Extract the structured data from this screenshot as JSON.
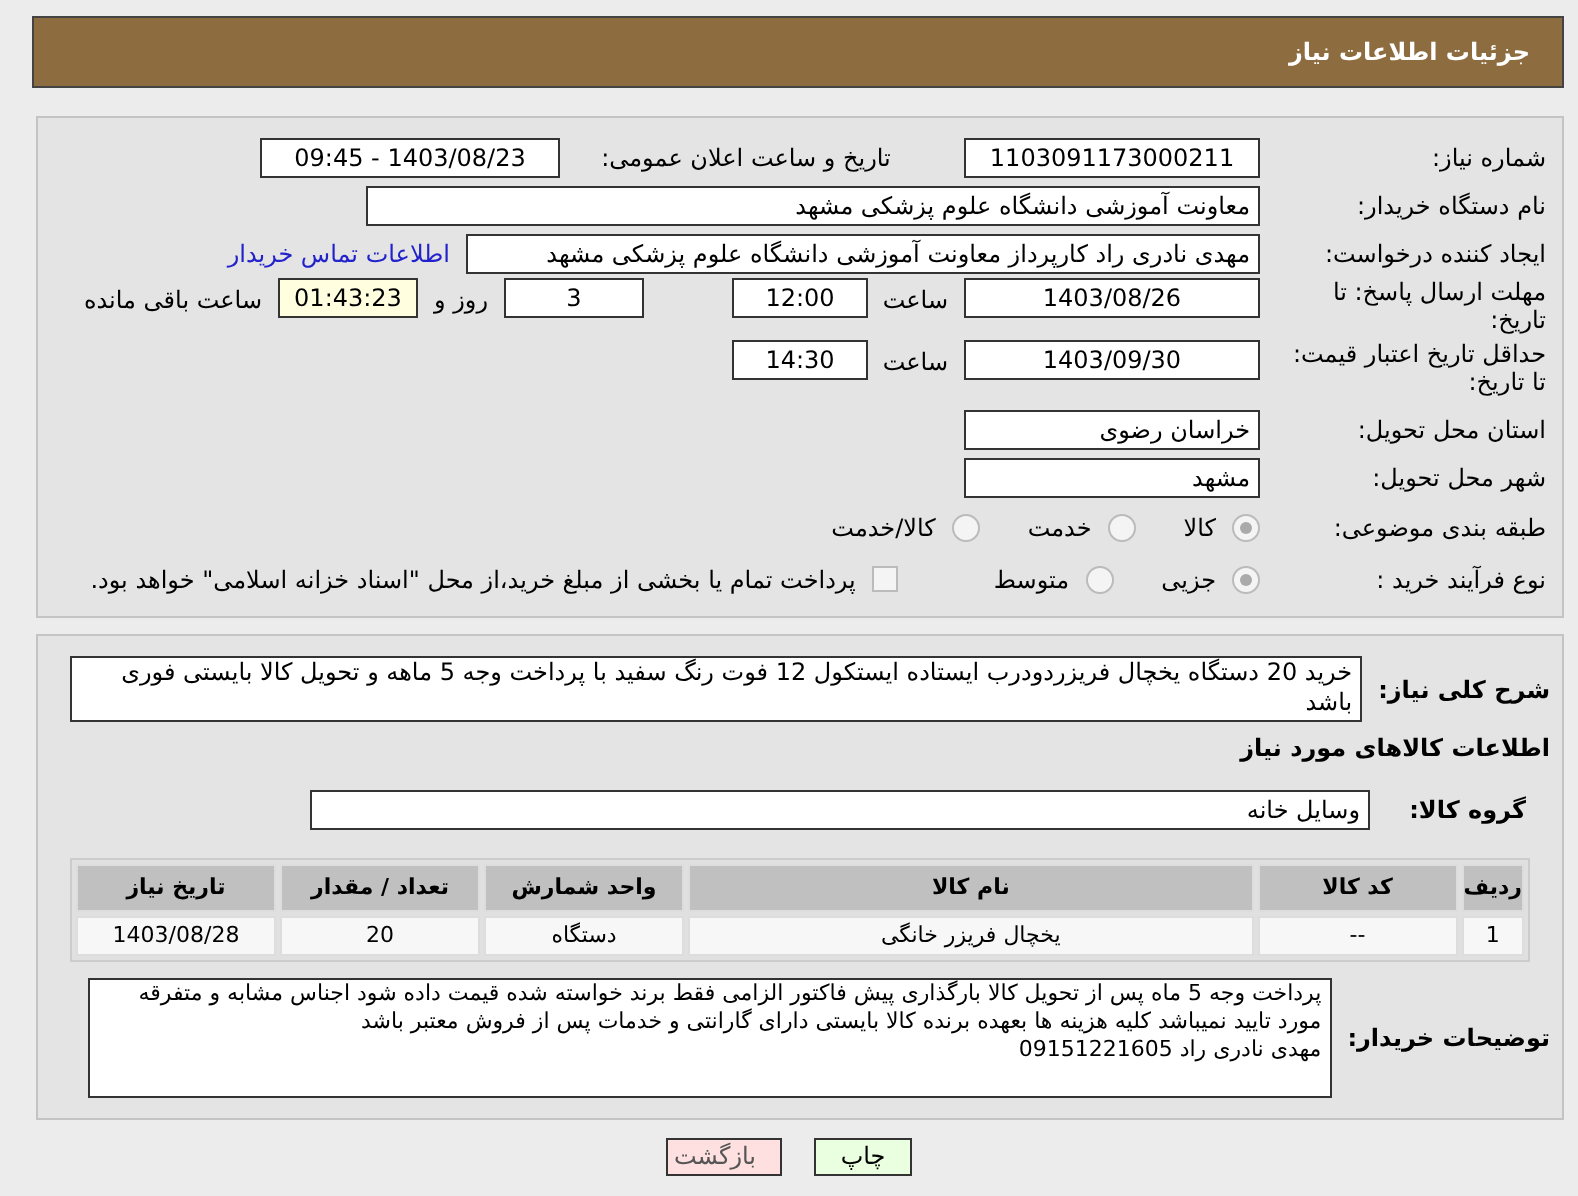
{
  "header": {
    "title": "جزئیات اطلاعات نیاز"
  },
  "need_number": {
    "label": "شماره نیاز:",
    "value": "1103091173000211"
  },
  "announce": {
    "label": "تاریخ و ساعت اعلان عمومی:",
    "value": "1403/08/23 - 09:45"
  },
  "buyer_org": {
    "label": "نام دستگاه خریدار:",
    "value": "معاونت آموزشی دانشگاه علوم پزشکی مشهد"
  },
  "requester": {
    "label": "ایجاد کننده درخواست:",
    "value": "مهدی نادری راد کارپرداز معاونت آموزشی دانشگاه علوم پزشکی مشهد",
    "link": "اطلاعات تماس خریدار"
  },
  "deadline": {
    "label": "مهلت ارسال پاسخ: تا تاریخ:",
    "date": "1403/08/26",
    "time_label": "ساعت",
    "time": "12:00",
    "days": "3",
    "days_label": "روز و",
    "remaining": "01:43:23",
    "remaining_label": "ساعت باقی مانده"
  },
  "validity": {
    "label": "حداقل تاریخ اعتبار قیمت: تا تاریخ:",
    "date": "1403/09/30",
    "time_label": "ساعت",
    "time": "14:30"
  },
  "province": {
    "label": "استان محل تحویل:",
    "value": "خراسان رضوی"
  },
  "city": {
    "label": "شهر محل تحویل:",
    "value": "مشهد"
  },
  "category": {
    "label": "طبقه بندی موضوعی:",
    "options": [
      {
        "label": "کالا",
        "selected": true
      },
      {
        "label": "خدمت",
        "selected": false
      },
      {
        "label": "کالا/خدمت",
        "selected": false
      }
    ]
  },
  "process": {
    "label": "نوع فرآیند خرید :",
    "options": [
      {
        "label": "جزیی",
        "selected": true
      },
      {
        "label": "متوسط",
        "selected": false
      }
    ],
    "treasury": {
      "label": "پرداخت تمام یا بخشی از مبلغ خرید،از محل \"اسناد خزانه اسلامی\" خواهد بود.",
      "checked": false
    }
  },
  "description": {
    "label": "شرح کلی نیاز:",
    "text": "خرید 20 دستگاه یخچال فریزردودرب ایستاده ایستکول 12 فوت رنگ سفید با پرداخت وجه 5 ماهه و تحویل کالا بایستی فوری باشد"
  },
  "goods_heading": "اطلاعات کالاهای مورد نیاز",
  "goods_group": {
    "label": "گروه کالا:",
    "value": "وسایل خانه"
  },
  "table": {
    "columns": [
      "ردیف",
      "کد کالا",
      "نام کالا",
      "واحد شمارش",
      "تعداد / مقدار",
      "تاریخ نیاز"
    ],
    "rows": [
      [
        "1",
        "--",
        "یخچال فریزر خانگی",
        "دستگاه",
        "20",
        "1403/08/28"
      ]
    ]
  },
  "buyer_notes": {
    "label": "توضیحات خریدار:",
    "lines": [
      "پرداخت وجه 5 ماه پس از تحویل کالا بارگذاری پیش فاکتور الزامی فقط برند خواسته شده قیمت داده شود اجناس مشابه و متفرقه مورد تایید نمیباشد کلیه هزینه ها بعهده برنده کالا بایستی دارای گارانتی و خدمات پس از فروش معتبر باشد",
      "مهدی نادری راد 09151221605"
    ]
  },
  "buttons": [
    {
      "label": "چاپ",
      "kind": "print"
    },
    {
      "label": "بازگشت",
      "kind": "back"
    }
  ]
}
